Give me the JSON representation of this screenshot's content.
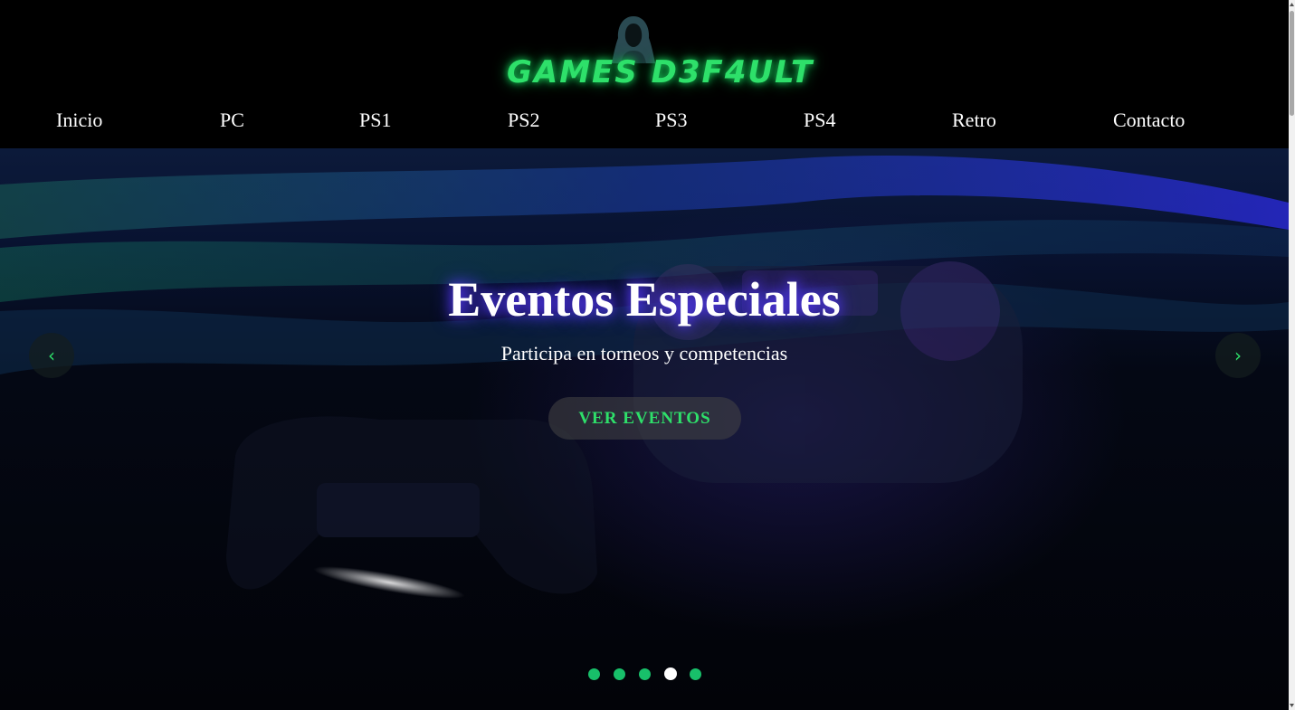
{
  "brand": {
    "logo_text": "GAMES D3F4ULT",
    "logo_color": "#2ee06a",
    "icon": "hooded-figure-icon"
  },
  "nav": {
    "items": [
      {
        "label": "Inicio"
      },
      {
        "label": "PC"
      },
      {
        "label": "PS1"
      },
      {
        "label": "PS2"
      },
      {
        "label": "PS3"
      },
      {
        "label": "PS4"
      },
      {
        "label": "Retro"
      },
      {
        "label": "Contacto"
      }
    ]
  },
  "hero": {
    "title": "Eventos Especiales",
    "subtitle": "Participa en torneos y competencias",
    "button_label": "VER EVENTOS",
    "prev_arrow": "‹",
    "next_arrow": "›",
    "slide_count": 5,
    "active_slide": 4,
    "accent_color": "#18c06a",
    "background_image": "game-controller-photo"
  }
}
